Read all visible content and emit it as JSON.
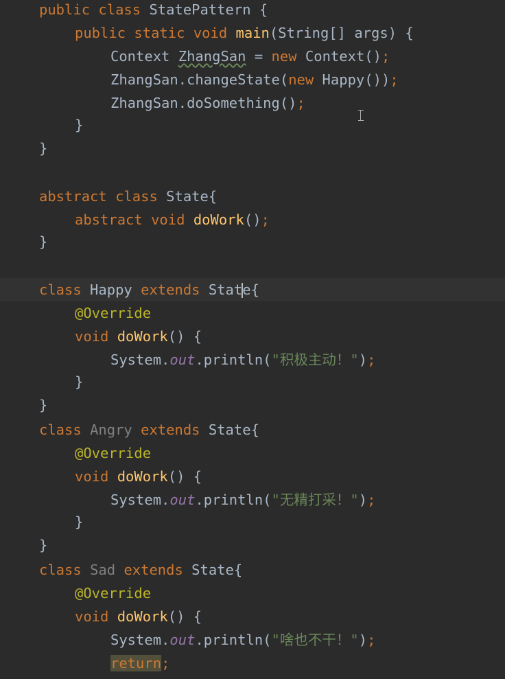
{
  "editor": {
    "theme_colors": {
      "background": "#2b2b2b",
      "keyword": "#cc7832",
      "function": "#ffc66d",
      "default_text": "#a9b7c6",
      "string": "#6a8759",
      "annotation": "#bbb529",
      "static_field": "#9876aa",
      "unused_identifier": "#808080"
    },
    "lines": {
      "l1": {
        "kw1": "public",
        "kw2": "class",
        "name": "StatePattern",
        "rest": " {"
      },
      "l2": {
        "kw1": "public",
        "kw2": "static",
        "kw3": "void",
        "fn": "main",
        "rest": "(String[] args) {"
      },
      "l3": {
        "type": "Context ",
        "var": "ZhangSan",
        "eq": " = ",
        "kw": "new",
        "rest": " Context()",
        "semi": ";"
      },
      "l4": {
        "pre": "ZhangSan.changeState(",
        "kw": "new",
        "rest": " Happy())",
        "semi": ";"
      },
      "l5": {
        "pre": "ZhangSan.doSomething()",
        "semi": ";"
      },
      "l6": {
        "text": "}"
      },
      "l7": {
        "text": "}"
      },
      "l8": {
        "kw1": "abstract",
        "kw2": "class",
        "rest": " State{"
      },
      "l9": {
        "kw1": "abstract",
        "kw2": "void",
        "fn": "doWork",
        "rest": "()",
        "semi": ";"
      },
      "l10": {
        "text": "}"
      },
      "l11": {
        "kw1": "class",
        "name": " Happy ",
        "kw2": "extends",
        "rest_a": " Stat",
        "rest_b": "e{"
      },
      "l12": {
        "ann": "@Override"
      },
      "l13": {
        "kw": "void",
        "fn": "doWork",
        "rest": "() {"
      },
      "l14": {
        "pre": "System.",
        "field": "out",
        "mid": ".println(",
        "str": "\"积极主动！\"",
        "close": ")",
        "semi": ";"
      },
      "l15": {
        "text": "}"
      },
      "l16": {
        "text": "}"
      },
      "l17": {
        "kw1": "class",
        "name": "Angry",
        "kw2": "extends",
        "rest": " State{"
      },
      "l18": {
        "ann": "@Override"
      },
      "l19": {
        "kw": "void",
        "fn": "doWork",
        "rest": "() {"
      },
      "l20": {
        "pre": "System.",
        "field": "out",
        "mid": ".println(",
        "str": "\"无精打采！\"",
        "close": ")",
        "semi": ";"
      },
      "l21": {
        "text": "}"
      },
      "l22": {
        "text": "}"
      },
      "l23": {
        "kw1": "class",
        "name": "Sad",
        "kw2": "extends",
        "rest": " State{"
      },
      "l24": {
        "ann": "@Override"
      },
      "l25": {
        "kw": "void",
        "fn": "doWork",
        "rest": "() {"
      },
      "l26": {
        "pre": "System.",
        "field": "out",
        "mid": ".println(",
        "str": "\"啥也不干！\"",
        "close": ")",
        "semi": ";"
      },
      "l27": {
        "kw": "return",
        "semi": ";"
      }
    }
  }
}
